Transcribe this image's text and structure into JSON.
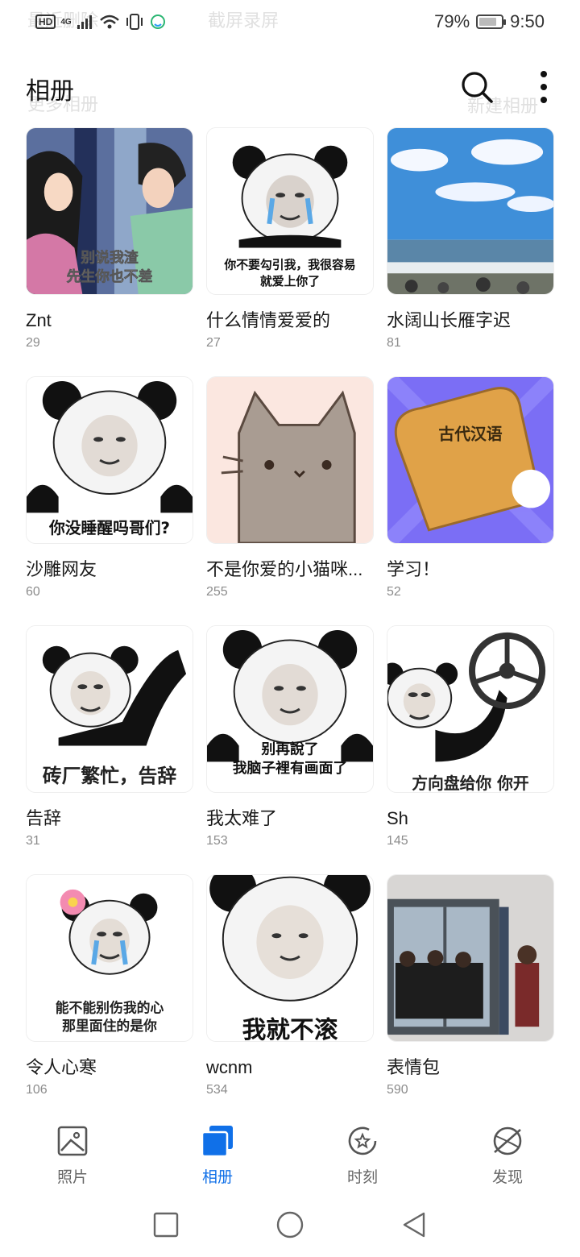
{
  "status_bar": {
    "hd": "HD",
    "network": "4G",
    "battery_level": 0.79,
    "battery_text": "79%",
    "time": "9:50"
  },
  "ghost_overlay": {
    "top_left": "最近删除",
    "top_center": "截屏录屏",
    "sub_left": "更多相册",
    "sub_right": "新建相册"
  },
  "header": {
    "title": "相册",
    "search_icon": "search-icon",
    "more_icon": "more-vertical-icon"
  },
  "albums": [
    {
      "name": "Znt",
      "count": "29",
      "thumb": "anime-couple",
      "caption": [
        "别说我渣",
        "先生你也不差"
      ]
    },
    {
      "name": "什么情情爱爱的",
      "count": "27",
      "thumb": "panda-crying",
      "caption": [
        "你不要勾引我，我很容易",
        "就爱上你了"
      ]
    },
    {
      "name": "水阔山长雁字迟",
      "count": "81",
      "thumb": "seascape",
      "caption": []
    },
    {
      "name": "沙雕网友",
      "count": "60",
      "thumb": "panda-face",
      "caption": [
        "你没睡醒吗哥们?"
      ]
    },
    {
      "name": "不是你爱的小猫咪...",
      "count": "255",
      "thumb": "cat",
      "caption": []
    },
    {
      "name": "学习！",
      "count": "52",
      "thumb": "toast-book",
      "caption": [
        "古代汉语"
      ]
    },
    {
      "name": "告辞",
      "count": "31",
      "thumb": "panda-wave",
      "caption": [
        "砖厂繁忙，告辞"
      ]
    },
    {
      "name": "我太难了",
      "count": "153",
      "thumb": "panda-face",
      "caption": [
        "别再說了",
        "我脑子裡有画面了"
      ]
    },
    {
      "name": "Sh",
      "count": "145",
      "thumb": "panda-wheel",
      "caption": [
        "方向盘给你 你开"
      ]
    },
    {
      "name": "令人心寒",
      "count": "106",
      "thumb": "panda-flower",
      "caption": [
        "能不能别伤我的心",
        "那里面住的是你"
      ]
    },
    {
      "name": "wcnm",
      "count": "534",
      "thumb": "panda-big",
      "caption": [
        "我就不滚"
      ]
    },
    {
      "name": "表情包",
      "count": "590",
      "thumb": "window-photo",
      "caption": []
    }
  ],
  "bottom_nav": [
    {
      "label": "照片",
      "icon": "photo-icon",
      "active": false
    },
    {
      "label": "相册",
      "icon": "albums-icon",
      "active": true
    },
    {
      "label": "时刻",
      "icon": "moments-icon",
      "active": false
    },
    {
      "label": "发现",
      "icon": "discover-icon",
      "active": false
    }
  ],
  "system_nav": [
    "recents-square-icon",
    "home-circle-icon",
    "back-triangle-icon"
  ],
  "colors": {
    "accent": "#1070e8",
    "muted_text": "#8c8c8c",
    "nav_text": "#666666"
  }
}
